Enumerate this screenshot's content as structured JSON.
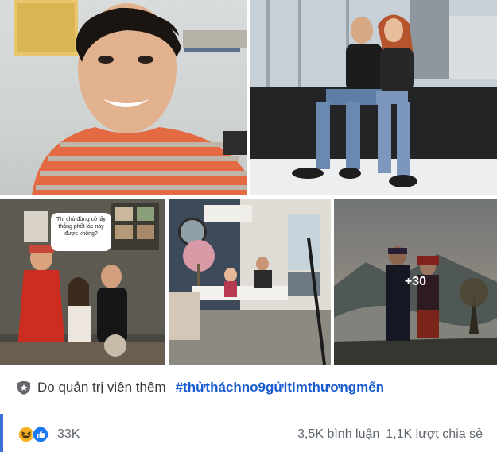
{
  "photos": {
    "speech_bubble": "Thí chủ đừng có lấy thắng phết lác này được không?",
    "more_overlay": "+30"
  },
  "post": {
    "admin_text": "Do quản trị viên thêm",
    "hashtag": "#thửtháchno9gửitimthươngmến"
  },
  "engagement": {
    "reactions_count": "33K",
    "comments": "3,5K bình luận",
    "shares": "1,1K lượt chia sẻ",
    "reaction_icons": [
      "haha-icon",
      "like-icon"
    ]
  },
  "colors": {
    "hashtag": "#1a5bd0",
    "like": "#1877f2",
    "haha": "#f7b125",
    "accent_bar": "#3b6fd6"
  }
}
